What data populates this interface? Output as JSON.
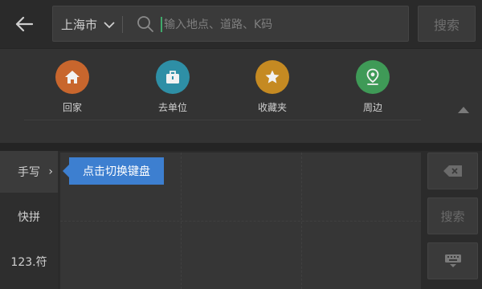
{
  "header": {
    "back_icon": "arrow-left-icon",
    "city": "上海市",
    "search_placeholder": "输入地点、道路、K码",
    "search_button": "搜索"
  },
  "quick_actions": [
    {
      "label": "回家",
      "icon": "home-icon",
      "color": "#c8662d"
    },
    {
      "label": "去单位",
      "icon": "briefcase-icon",
      "color": "#2e8fa6"
    },
    {
      "label": "收藏夹",
      "icon": "star-icon",
      "color": "#c58a22"
    },
    {
      "label": "周边",
      "icon": "location-pin-icon",
      "color": "#3f9a57"
    }
  ],
  "keyboard": {
    "modes": [
      "手写",
      "快拼",
      "123.符"
    ],
    "active_mode": "手写",
    "tooltip": "点击切换键盘",
    "right_buttons": {
      "delete_icon": "backspace-icon",
      "search_label": "搜索",
      "hide_icon": "keyboard-hide-icon"
    }
  },
  "colors": {
    "background": "#2b2b2b",
    "panel": "#333333",
    "accent_blue": "#3d7fd0",
    "cursor_green": "#3fa96b"
  }
}
